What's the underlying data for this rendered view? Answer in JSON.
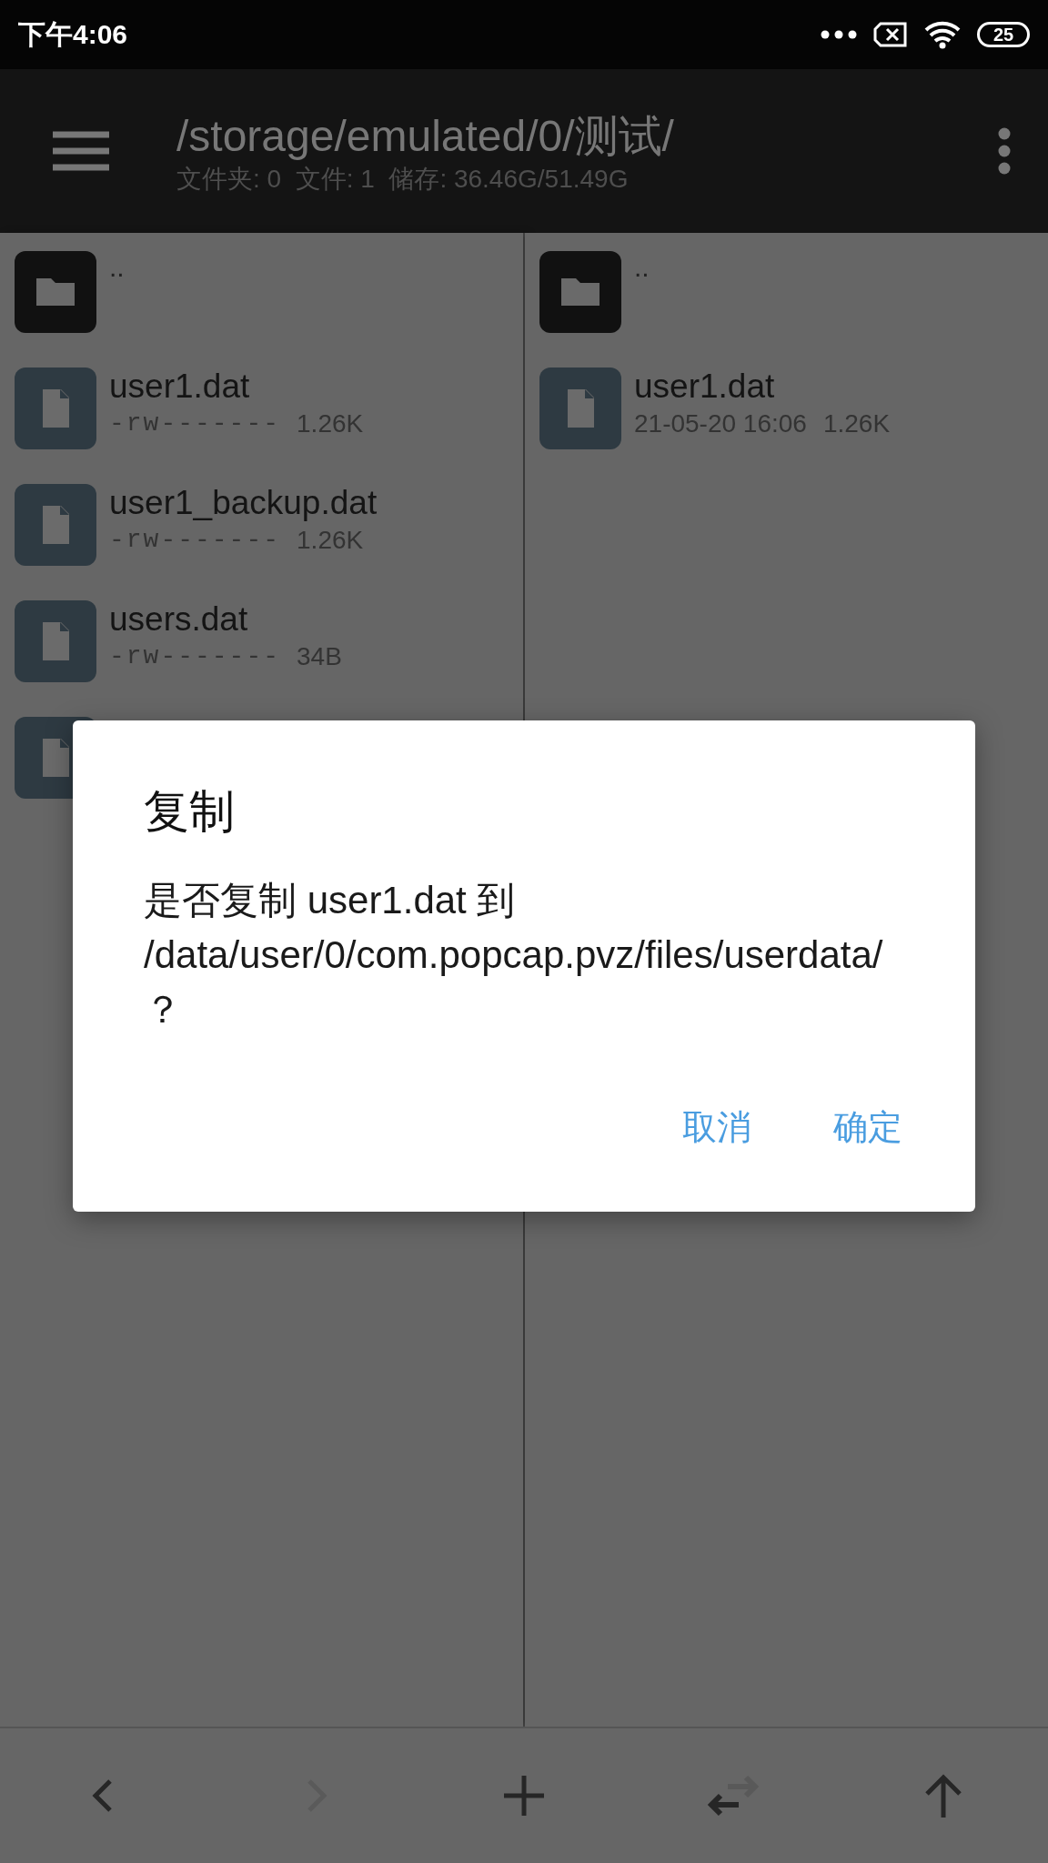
{
  "status_bar": {
    "time": "下午4:06",
    "battery": "25"
  },
  "toolbar": {
    "path": "/storage/emulated/0/测试/",
    "info": "文件夹: 0  文件: 1  储存: 36.46G/51.49G"
  },
  "panes": [
    {
      "items": [
        {
          "kind": "folder",
          "name": ".."
        },
        {
          "kind": "file",
          "name": "user1.dat",
          "permissions": "-rw-------",
          "size": "1.26K"
        },
        {
          "kind": "file",
          "name": "user1_backup.dat",
          "permissions": "-rw-------",
          "size": "1.26K"
        },
        {
          "kind": "file",
          "name": "users.dat",
          "permissions": "-rw-------",
          "size": "34B"
        },
        {
          "kind": "file"
        }
      ]
    },
    {
      "items": [
        {
          "kind": "folder",
          "name": ".."
        },
        {
          "kind": "file",
          "name": "user1.dat",
          "date": "21-05-20 16:06",
          "size": "1.26K"
        }
      ]
    }
  ],
  "dialog": {
    "title": "复制",
    "message": {
      "text": "是否复制 user1.dat 到 ",
      "path": "/data/user/0/com.popcap.pvz/files/userdata/？"
    },
    "buttons": [
      "取消",
      "确定"
    ]
  },
  "nav": [
    {
      "kind": "back",
      "disabled": false
    },
    {
      "kind": "forward",
      "disabled": true
    },
    {
      "kind": "new",
      "disabled": false
    },
    {
      "kind": "swap",
      "disabled": false
    },
    {
      "kind": "up",
      "disabled": false
    }
  ]
}
